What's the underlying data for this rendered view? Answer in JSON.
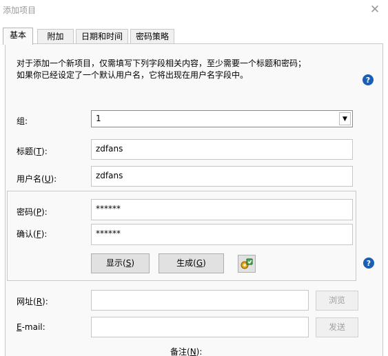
{
  "window": {
    "title": "添加项目",
    "close_glyph": "✕"
  },
  "tabs": [
    {
      "label": "基本",
      "active": true
    },
    {
      "label": "附加",
      "active": false
    },
    {
      "label": "日期和时间",
      "active": false
    },
    {
      "label": "密码策略",
      "active": false
    }
  ],
  "intro": {
    "line1": "对于添加一个新项目，仅需填写下列字段相关内容，至少需要一个标题和密码；",
    "line2": "如果你已经设定了一个默认用户名，它将出现在用户名字段中。"
  },
  "help_glyph": "?",
  "form": {
    "group_label": "组:",
    "group_value": "1",
    "title_label": "标题(",
    "title_key": "T",
    "title_value": "zdfans",
    "username_label": "用户名(",
    "username_key": "U",
    "username_value": "zdfans",
    "password_label": "密码(",
    "password_key": "P",
    "password_value": "******",
    "confirm_label": "确认(",
    "confirm_key": "F",
    "confirm_value": "******",
    "show_label": "显示(",
    "show_key": "S",
    "generate_label": "生成(",
    "generate_key": "G",
    "url_label": "网址(",
    "url_key": "R",
    "url_value": "",
    "browse_label": "浏览",
    "email_key": "E",
    "email_label": "-mail:",
    "email_value": "",
    "send_label": "发送",
    "notes_label": "备注(",
    "notes_key": "N"
  },
  "suffix": "):",
  "btn_suffix": ")"
}
